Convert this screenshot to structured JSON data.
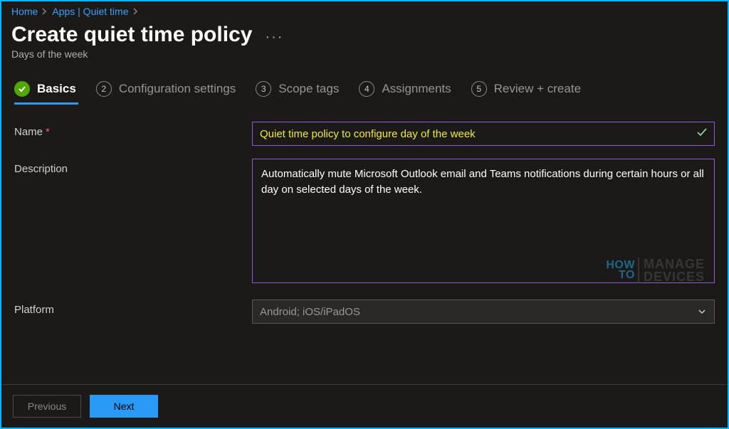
{
  "breadcrumb": {
    "items": [
      {
        "label": "Home"
      },
      {
        "label": "Apps | Quiet time"
      }
    ]
  },
  "header": {
    "title": "Create quiet time policy",
    "subtitle": "Days of the week"
  },
  "wizard": {
    "steps": [
      {
        "num": "✓",
        "label": "Basics"
      },
      {
        "num": "2",
        "label": "Configuration settings"
      },
      {
        "num": "3",
        "label": "Scope tags"
      },
      {
        "num": "4",
        "label": "Assignments"
      },
      {
        "num": "5",
        "label": "Review + create"
      }
    ]
  },
  "form": {
    "name_label": "Name",
    "name_value": "Quiet time policy to configure day of the week",
    "description_label": "Description",
    "description_value": "Automatically mute Microsoft Outlook email and Teams notifications during certain hours or all day on selected days of the week.",
    "platform_label": "Platform",
    "platform_value": "Android; iOS/iPadOS"
  },
  "footer": {
    "previous": "Previous",
    "next": "Next"
  },
  "watermark": {
    "line1": "HOW",
    "line2": "TO",
    "line3": "MANAGE",
    "line4": "DEVICES"
  }
}
